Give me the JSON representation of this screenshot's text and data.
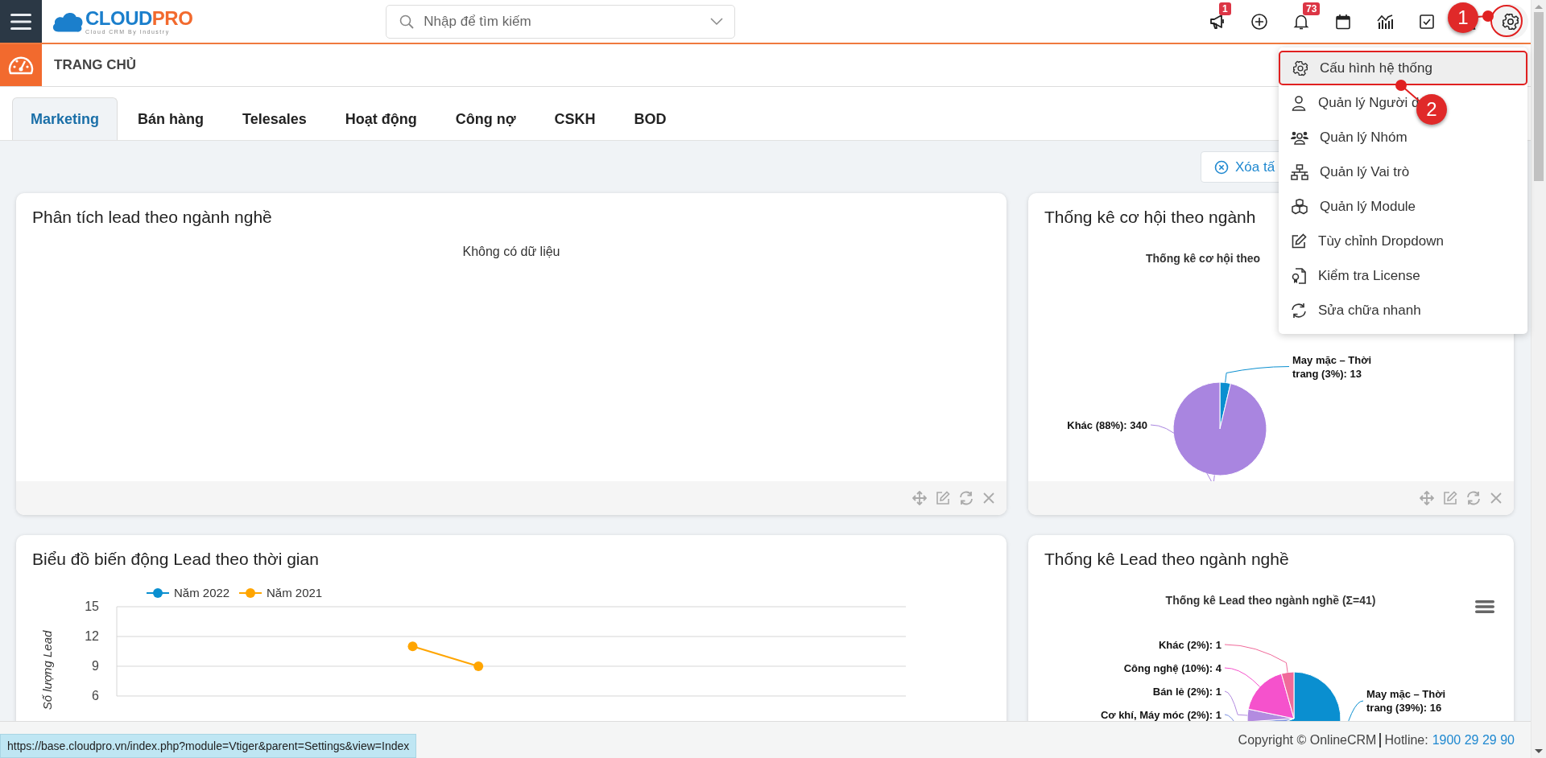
{
  "topbar": {
    "logo": {
      "brand_primary": "CLOUD",
      "brand_accent": "PRO",
      "tagline": "Cloud CRM By Industry"
    },
    "search": {
      "placeholder": "Nhập để tìm kiếm"
    },
    "actions": [
      {
        "kind": "megaphone",
        "badge": "1",
        "selected": false
      },
      {
        "kind": "add",
        "selected": false
      },
      {
        "kind": "bell",
        "badge": "73",
        "selected": false
      },
      {
        "kind": "calendar",
        "selected": false
      },
      {
        "kind": "report",
        "selected": false
      },
      {
        "kind": "task",
        "selected": false
      },
      {
        "kind": "user",
        "selected": false
      },
      {
        "kind": "settings",
        "selected": true
      }
    ]
  },
  "page_header": {
    "title": "TRANG CHỦ"
  },
  "tabs": [
    {
      "label": "Marketing",
      "selected": true
    },
    {
      "label": "Bán hàng",
      "selected": false
    },
    {
      "label": "Telesales",
      "selected": false
    },
    {
      "label": "Hoạt động",
      "selected": false
    },
    {
      "label": "Công nợ",
      "selected": false
    },
    {
      "label": "CSKH",
      "selected": false
    },
    {
      "label": "BOD",
      "selected": false
    }
  ],
  "clear_filter_button": {
    "label": "Xóa tấ"
  },
  "widgets": [
    {
      "kind": "empty",
      "title": "Phân tích lead theo ngành nghề",
      "message": "Không có dữ liệu",
      "toolbar": true
    },
    {
      "kind": "chart",
      "title": "Thống kê cơ hội theo ngành",
      "toolbar": true,
      "chart_data": {
        "type": "pie",
        "title": "Thống kê cơ hội theo",
        "categories": [
          "May mặc – Thời trang",
          "Khác"
        ],
        "values": [
          13,
          340
        ],
        "colors": [
          "#0a8fd0",
          "#a985e0"
        ],
        "value_labels": [
          "(3%): 13",
          "(88%): 340"
        ]
      }
    },
    {
      "kind": "chart",
      "title": "Biểu đồ biến động Lead theo thời gian",
      "chart_data": {
        "type": "line",
        "ylabel": "Số lượng Lead",
        "ylim": [
          6,
          15
        ],
        "yticks": [
          6,
          9,
          12,
          15
        ],
        "grid": true,
        "legend": "top",
        "series": [
          {
            "name": "Năm 2022",
            "color": "#0a8fd0",
            "marker": true,
            "values": [
              null,
              null,
              null,
              null,
              null,
              null,
              null,
              null,
              null,
              null,
              null,
              null
            ]
          },
          {
            "name": "Năm 2021",
            "color": "#ffa500",
            "marker": true,
            "values": [
              null,
              null,
              null,
              null,
              11,
              9,
              null,
              null,
              null,
              null,
              null,
              null
            ]
          }
        ]
      }
    },
    {
      "kind": "chart",
      "title": "Thống kê Lead theo ngành nghề",
      "menu": true,
      "chart_data": {
        "type": "pie",
        "title": "Thống kê Lead theo ngành nghề (Σ=41)",
        "categories": [
          "May mặc – Thời trang",
          "Cơ khí, Máy móc",
          "Bán lẻ",
          "Công nghệ",
          "Khác"
        ],
        "values": [
          16,
          1,
          1,
          4,
          1
        ],
        "colors": [
          "#0a8fd0",
          "#7d8fe0",
          "#b38be0",
          "#f552cc",
          "#f06a9a"
        ],
        "value_labels": [
          "(39%): 16",
          "(2%): 1",
          "(2%): 1",
          "(10%): 4",
          "(2%): 1"
        ]
      }
    }
  ],
  "settings_menu": {
    "items": [
      {
        "kind": "gear",
        "label": "Cấu hình hệ thống",
        "selected": true
      },
      {
        "kind": "user",
        "label": "Quản lý Người d",
        "selected": false
      },
      {
        "kind": "group",
        "label": "Quản lý Nhóm",
        "selected": false
      },
      {
        "kind": "hierarchy",
        "label": "Quản lý Vai trò",
        "selected": false
      },
      {
        "kind": "boxes",
        "label": "Quản lý Module",
        "selected": false
      },
      {
        "kind": "edit",
        "label": "Tùy chỉnh Dropdown",
        "selected": false
      },
      {
        "kind": "license",
        "label": "Kiểm tra License",
        "selected": false
      },
      {
        "kind": "repair",
        "label": "Sửa chữa nhanh",
        "selected": false
      }
    ]
  },
  "annotations": [
    {
      "label": "1"
    },
    {
      "label": "2"
    }
  ],
  "footer": {
    "copyright": "Copyright © OnlineCRM",
    "hotline_label": "Hotline:",
    "hotline": "1900 29 29 90"
  },
  "status_url": "https://base.cloudpro.vn/index.php?module=Vtiger&parent=Settings&view=Index"
}
